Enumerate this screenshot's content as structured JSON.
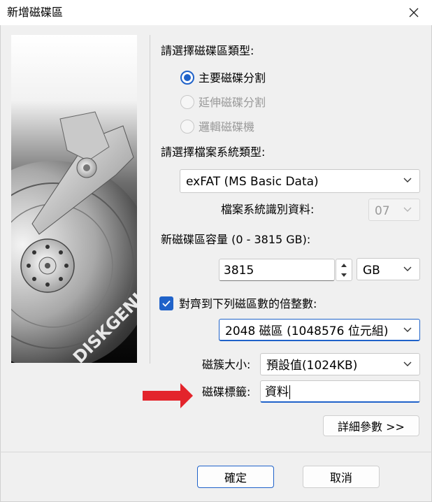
{
  "window": {
    "title": "新增磁碟區"
  },
  "branding": {
    "logo_text": "DISKGENIUS"
  },
  "partition_type": {
    "label": "請選擇磁碟區類型:",
    "options": [
      {
        "label": "主要磁碟分割",
        "checked": true,
        "enabled": true
      },
      {
        "label": "延伸磁碟分割",
        "checked": false,
        "enabled": false
      },
      {
        "label": "邏輯磁碟機",
        "checked": false,
        "enabled": false
      }
    ]
  },
  "file_system": {
    "label": "請選擇檔案系統類型:",
    "value": "exFAT (MS Basic Data)",
    "id_label": "檔案系統識別資料:",
    "id_value": "07"
  },
  "size": {
    "label": "新磁碟區容量 (0 - 3815 GB):",
    "value": "3815",
    "unit": "GB"
  },
  "align": {
    "checked": true,
    "label": "對齊到下列磁區數的倍整數:",
    "value": "2048 磁區 (1048576 位元組)"
  },
  "cluster": {
    "label": "磁簇大小:",
    "value": "預設值(1024KB)"
  },
  "volume_label": {
    "label": "磁碟標籤:",
    "value": "資料"
  },
  "buttons": {
    "details": "詳細參數 >>",
    "ok": "確定",
    "cancel": "取消"
  },
  "annotation": {
    "arrow_color": "#e3242b"
  },
  "colors": {
    "accent": "#1f62c9"
  }
}
